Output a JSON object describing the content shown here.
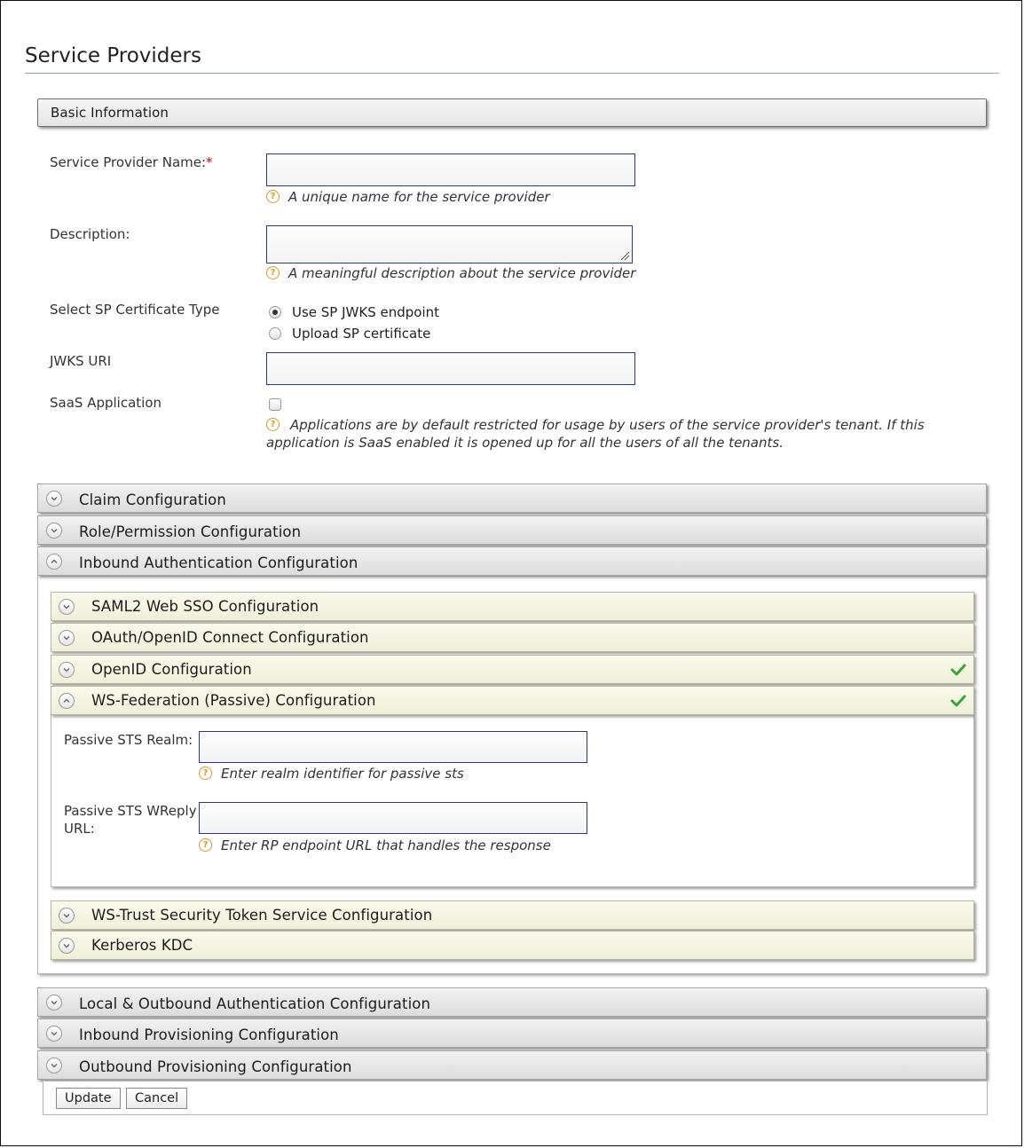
{
  "page": {
    "title": "Service Providers"
  },
  "basic": {
    "bar_label": "Basic Information",
    "sp_name_label": "Service Provider Name:",
    "required_mark": "*",
    "sp_name_value": "",
    "sp_name_help": "A unique name for the service provider",
    "description_label": "Description:",
    "description_value": "",
    "description_help": "A meaningful description about the service provider",
    "cert_type_label": "Select SP Certificate Type",
    "cert_options": [
      {
        "label": "Use SP JWKS endpoint",
        "selected": true
      },
      {
        "label": "Upload SP certificate",
        "selected": false
      }
    ],
    "jwks_label": "JWKS URI",
    "jwks_value": "",
    "saas_label": "SaaS Application",
    "saas_checked": false,
    "saas_help": "Applications are by default restricted for usage by users of the service provider's tenant. If this application is SaaS enabled it is opened up for all the users of all the tenants."
  },
  "sections": {
    "claim": "Claim Configuration",
    "role": "Role/Permission Configuration",
    "inbound_auth": "Inbound Authentication Configuration",
    "local_outbound": "Local & Outbound Authentication Configuration",
    "inbound_prov": "Inbound Provisioning Configuration",
    "outbound_prov": "Outbound Provisioning Configuration"
  },
  "inbound": {
    "saml": "SAML2 Web SSO Configuration",
    "oauth": "OAuth/OpenID Connect Configuration",
    "openid": "OpenID Configuration",
    "wsfed": "WS-Federation (Passive) Configuration",
    "wstrust": "WS-Trust Security Token Service Configuration",
    "kerberos": "Kerberos KDC"
  },
  "wsfed": {
    "realm_label": "Passive STS Realm:",
    "realm_value": "",
    "realm_help": "Enter realm identifier for passive sts",
    "wreply_label": "Passive STS WReply URL:",
    "wreply_value": "",
    "wreply_help": "Enter RP endpoint URL that handles the response"
  },
  "buttons": {
    "update": "Update",
    "cancel": "Cancel"
  },
  "icons": {
    "help": "question-circle-icon",
    "expand": "chevron-down-icon",
    "collapse": "chevron-up-icon",
    "configured": "checkmark-icon"
  },
  "colors": {
    "check": "#3aa33a",
    "help_icon": "#d49a27",
    "required": "#d30000"
  }
}
